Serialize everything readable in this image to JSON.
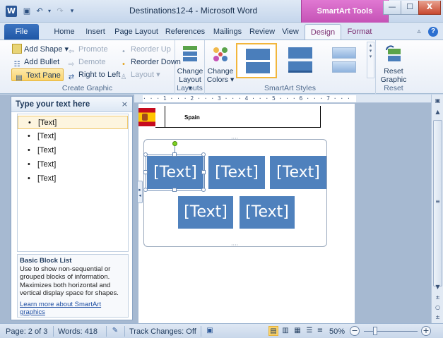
{
  "window": {
    "title": "Destinations12-4 - Microsoft Word",
    "context_tab_label": "SmartArt Tools",
    "app_icon": "W",
    "controls": {
      "minimize": "—",
      "maximize": "☐",
      "close": "X"
    }
  },
  "qat": {
    "save_icon": "save-icon",
    "undo_icon": "undo-icon",
    "redo_icon": "redo-icon"
  },
  "tabs": {
    "file": "File",
    "items": [
      "Home",
      "Insert",
      "Page Layout",
      "References",
      "Mailings",
      "Review",
      "View",
      "Design",
      "Format"
    ],
    "active": "Design"
  },
  "ribbon": {
    "create_graphic": {
      "label": "Create Graphic",
      "add_shape": "Add Shape",
      "add_bullet": "Add Bullet",
      "text_pane": "Text Pane",
      "promote": "Promote",
      "demote": "Demote",
      "right_to_left": "Right to Left",
      "reorder_up": "Reorder Up",
      "reorder_down": "Reorder Down",
      "layout": "Layout"
    },
    "layouts": {
      "label": "Layouts",
      "change_layout_l1": "Change",
      "change_layout_l2": "Layout"
    },
    "smartart_styles": {
      "label": "SmartArt Styles",
      "change_colors_l1": "Change",
      "change_colors_l2": "Colors"
    },
    "reset": {
      "label": "Reset",
      "reset_graphic_l1": "Reset",
      "reset_graphic_l2": "Graphic"
    }
  },
  "ruler": {
    "text": "  ·  ·  · 1 ·  ·  · 2 ·  ·  · 3 ·  ·  · 4 ·  ·  · 5 ·  ·  · 6 ·  ·  · 7 ·  ·  ·"
  },
  "text_pane": {
    "title": "Type your text here",
    "close": "×",
    "items": [
      "[Text]",
      "[Text]",
      "[Text]",
      "[Text]",
      "[Text]"
    ],
    "description": {
      "title": "Basic Block List",
      "body": "Use to show non-sequential or grouped blocks of information. Maximizes both horizontal and vertical display space for shapes.",
      "link": "Learn more about SmartArt graphics"
    }
  },
  "document": {
    "table_country": "Spain",
    "smartart_blocks": [
      "[Text]",
      "[Text]",
      "[Text]",
      "[Text]",
      "[Text]"
    ]
  },
  "statusbar": {
    "page": "Page: 2 of 3",
    "words": "Words: 418",
    "track_changes": "Track Changes: Off",
    "zoom": "50%",
    "zoom_fraction": 0.5,
    "zoom_out": "−",
    "zoom_in": "+"
  },
  "colors": {
    "smartart_fill": "#4f81bd",
    "context_tab": "#c552b6",
    "file_tab": "#2b5797",
    "selected_button": "#fbd36b"
  }
}
